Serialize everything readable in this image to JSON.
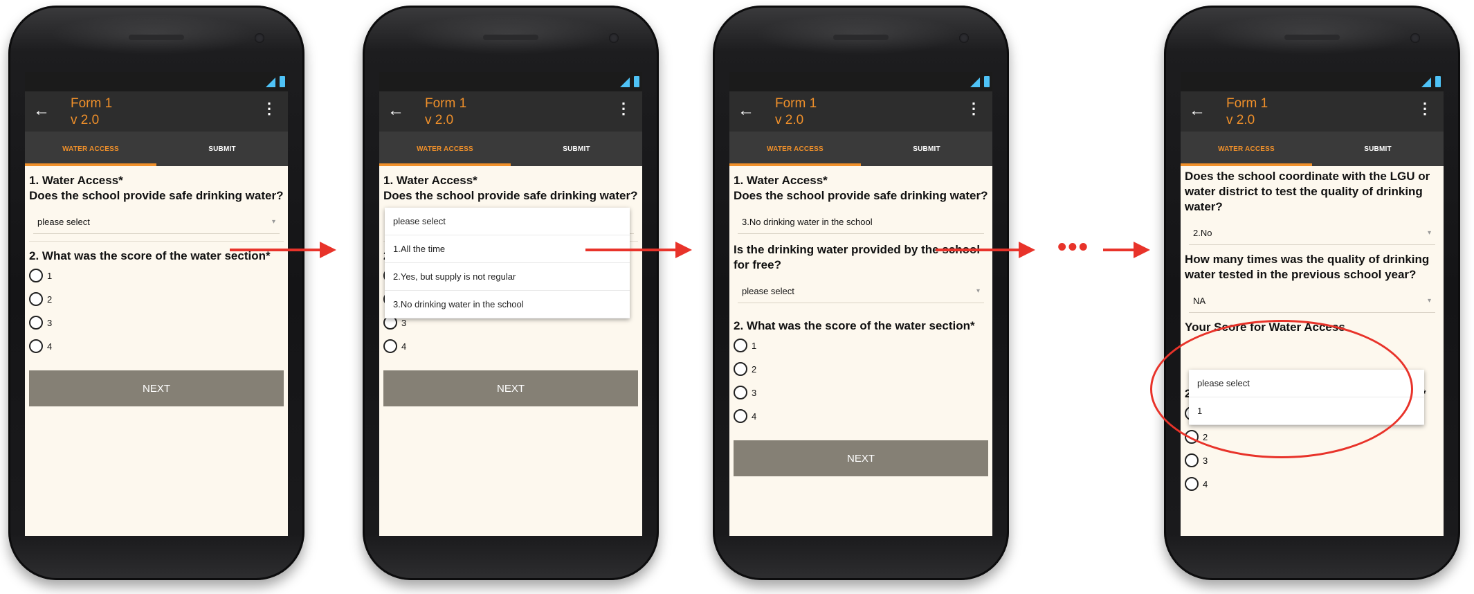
{
  "app": {
    "title": "Form 1",
    "version": "v 2.0"
  },
  "tabs": [
    "WATER ACCESS",
    "SUBMIT"
  ],
  "next_label": "NEXT",
  "q1": {
    "title": "1. Water Access*",
    "question": "Does the school provide safe drinking water?"
  },
  "placeholder": "please select",
  "q1_options": [
    "1.All the time",
    "2.Yes, but supply is not regular",
    "3.No drinking water in the school"
  ],
  "q1_selected_screen3": "3.No drinking water in the school",
  "q_free": "Is the drinking water provided by the school for free?",
  "q2": "2. What was the score of the water section*",
  "q2_options": [
    "1",
    "2",
    "3",
    "4"
  ],
  "screen4": {
    "q_lgu": "Does the school coordinate with the LGU or water district to test the quality of drinking water?",
    "q_lgu_value": "2.No",
    "q_times": "How many times was the quality of drinking water tested in the previous school year?",
    "q_times_value": "NA",
    "q_score": "Your Score for Water Access",
    "score_dropdown": [
      "please select",
      "1"
    ]
  },
  "ellipsis": "•••",
  "colors": {
    "accent": "#f0902a",
    "arrow": "#e8332a",
    "screen_bg": "#fdf8ee"
  }
}
